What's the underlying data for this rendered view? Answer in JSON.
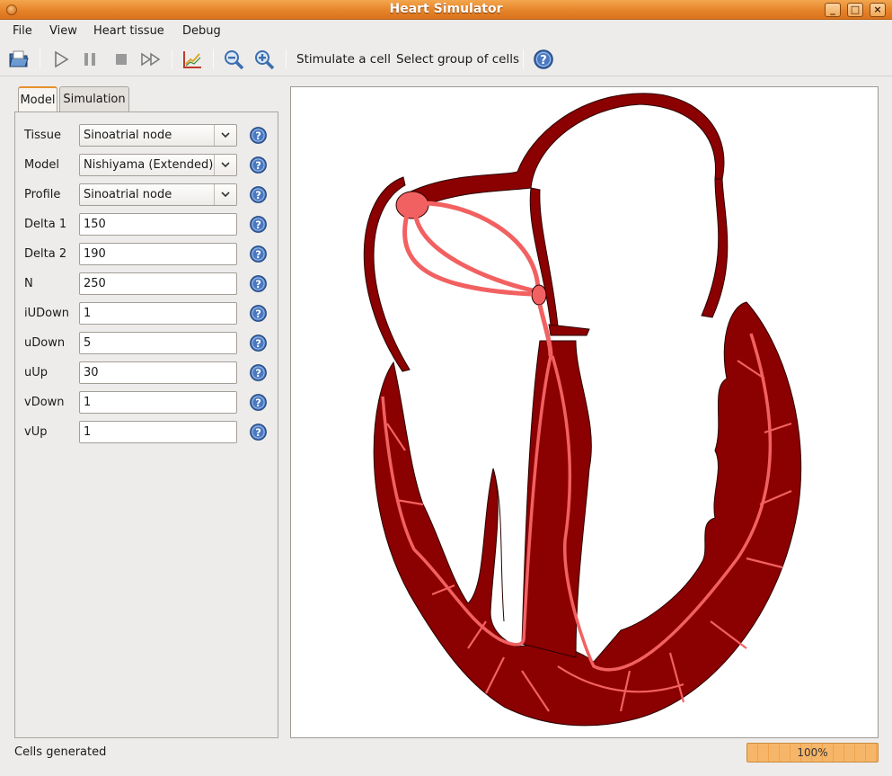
{
  "window": {
    "title": "Heart Simulator"
  },
  "menu": [
    "File",
    "View",
    "Heart tissue",
    "Debug"
  ],
  "toolbar": {
    "stimulate_label": "Stimulate a cell",
    "select_group_label": "Select group of cells"
  },
  "tabs": [
    {
      "label": "Model",
      "active": true
    },
    {
      "label": "Simulation",
      "active": false
    }
  ],
  "fields": {
    "tissue": {
      "label": "Tissue",
      "value": "Sinoatrial node"
    },
    "model": {
      "label": "Model",
      "value": "Nishiyama (Extended)"
    },
    "profile": {
      "label": "Profile",
      "value": "Sinoatrial node"
    },
    "delta1": {
      "label": "Delta 1",
      "value": "150"
    },
    "delta2": {
      "label": "Delta 2",
      "value": "190"
    },
    "n": {
      "label": "N",
      "value": "250"
    },
    "iudown": {
      "label": "iUDown",
      "value": "1"
    },
    "udown": {
      "label": "uDown",
      "value": "5"
    },
    "uup": {
      "label": "uUp",
      "value": "30"
    },
    "vdown": {
      "label": "vDown",
      "value": "1"
    },
    "vup": {
      "label": "vUp",
      "value": "1"
    }
  },
  "status": {
    "message": "Cells generated",
    "progress_text": "100%",
    "progress_fraction": 1.0
  },
  "colors": {
    "tissue": "#8b0000",
    "conduction": "#f26161",
    "accent": "#e8912b"
  }
}
